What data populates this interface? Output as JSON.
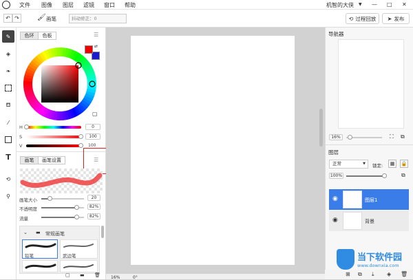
{
  "app": {
    "menus": [
      "文件",
      "图像",
      "图层",
      "滤镜",
      "窗口",
      "帮助"
    ],
    "user": "机智的大侠",
    "window_controls": [
      "—",
      "□",
      "✕"
    ]
  },
  "toolbar": {
    "brush_label": "画笔",
    "stabilizer": "抖动修正：0",
    "history_label": "过程回放",
    "publish_label": "发布"
  },
  "color_panel": {
    "tabs": [
      "色环",
      "色板"
    ],
    "h_label": "H",
    "s_label": "S",
    "v_label": "V",
    "h_value": "0",
    "s_value": "100",
    "v_value": "100",
    "fg_color": "#ee0000",
    "bg_color": "#1a1acc",
    "hue": 0,
    "sat": 1.0,
    "val": 1.0
  },
  "brush_panel": {
    "tabs": [
      "画笔",
      "画笔设置"
    ],
    "size_label": "画笔大小",
    "size_value": "20",
    "opacity_label": "不透明度",
    "opacity_value": "82%",
    "flow_label": "流量",
    "flow_value": "82%",
    "size_level": 0.2,
    "opacity_level": 0.82,
    "flow_level": 0.82,
    "group": "常规画笔",
    "brush_names": [
      "铅笔",
      "武边笔"
    ]
  },
  "status": {
    "zoom": "16%",
    "rotation": "0°"
  },
  "navigator": {
    "title": "导航器",
    "zoom": "16%"
  },
  "layers": {
    "title": "图层",
    "blend": "正常",
    "lock_label": "锁定:",
    "opacity": "100%",
    "items": [
      {
        "name": "图层1"
      },
      {
        "name": "背景"
      }
    ]
  },
  "watermark": {
    "line1": "当下软件园",
    "line2": "www.downxia.com"
  },
  "colors": {
    "accent": "#3b7de8",
    "highlight": "#e02020"
  }
}
